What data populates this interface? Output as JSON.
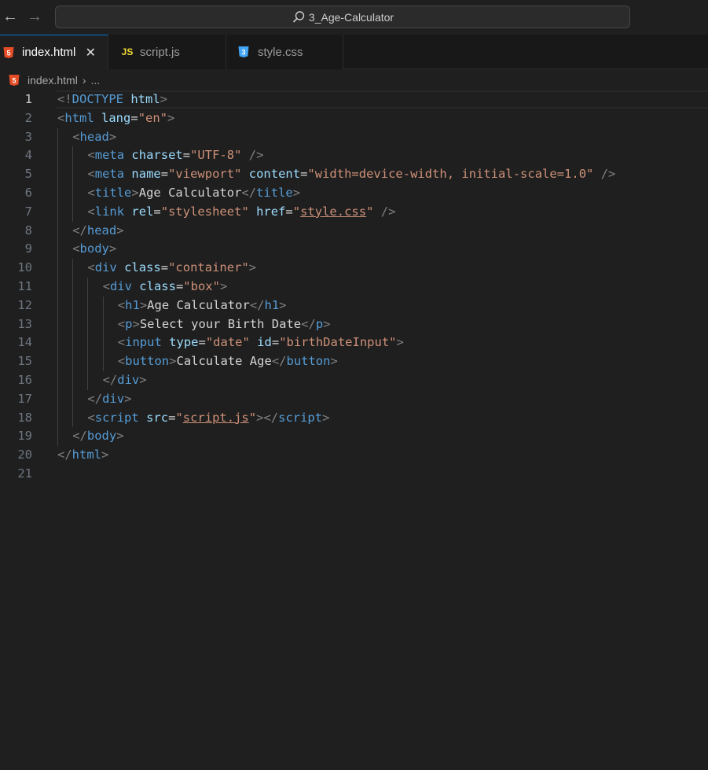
{
  "titlebar": {
    "search_text": "3_Age-Calculator"
  },
  "tabs": [
    {
      "label": "index.html",
      "icon": "html5-icon",
      "icon_glyph": "5",
      "icon_color": "#e44d26",
      "active": true
    },
    {
      "label": "script.js",
      "icon": "javascript-icon",
      "icon_glyph": "JS",
      "icon_color": "#f1dd35",
      "active": false
    },
    {
      "label": "style.css",
      "icon": "css3-icon",
      "icon_glyph": "3",
      "icon_color": "#42a5f5",
      "active": false
    }
  ],
  "breadcrumb": {
    "file": "index.html",
    "ellipsis": "..."
  },
  "editor": {
    "active_line": 1,
    "lines": [
      {
        "n": "1",
        "indent": 0,
        "tokens": [
          [
            "br",
            "<!"
          ],
          [
            "tag",
            "DOCTYPE"
          ],
          [
            "txt",
            " "
          ],
          [
            "attr",
            "html"
          ],
          [
            "br",
            ">"
          ]
        ]
      },
      {
        "n": "2",
        "indent": 0,
        "tokens": [
          [
            "br",
            "<"
          ],
          [
            "tag",
            "html"
          ],
          [
            "txt",
            " "
          ],
          [
            "attr",
            "lang"
          ],
          [
            "eq",
            "="
          ],
          [
            "str",
            "\"en\""
          ],
          [
            "br",
            ">"
          ]
        ]
      },
      {
        "n": "3",
        "indent": 1,
        "tokens": [
          [
            "br",
            "<"
          ],
          [
            "tag",
            "head"
          ],
          [
            "br",
            ">"
          ]
        ]
      },
      {
        "n": "4",
        "indent": 2,
        "tokens": [
          [
            "br",
            "<"
          ],
          [
            "tag",
            "meta"
          ],
          [
            "txt",
            " "
          ],
          [
            "attr",
            "charset"
          ],
          [
            "eq",
            "="
          ],
          [
            "str",
            "\"UTF-8\""
          ],
          [
            "txt",
            " "
          ],
          [
            "br",
            "/>"
          ]
        ]
      },
      {
        "n": "5",
        "indent": 2,
        "tokens": [
          [
            "br",
            "<"
          ],
          [
            "tag",
            "meta"
          ],
          [
            "txt",
            " "
          ],
          [
            "attr",
            "name"
          ],
          [
            "eq",
            "="
          ],
          [
            "str",
            "\"viewport\""
          ],
          [
            "txt",
            " "
          ],
          [
            "attr",
            "content"
          ],
          [
            "eq",
            "="
          ],
          [
            "str",
            "\"width=device-width, initial-scale=1.0\""
          ],
          [
            "txt",
            " "
          ],
          [
            "br",
            "/>"
          ]
        ]
      },
      {
        "n": "6",
        "indent": 2,
        "tokens": [
          [
            "br",
            "<"
          ],
          [
            "tag",
            "title"
          ],
          [
            "br",
            ">"
          ],
          [
            "txt",
            "Age Calculator"
          ],
          [
            "br",
            "</"
          ],
          [
            "tag",
            "title"
          ],
          [
            "br",
            ">"
          ]
        ]
      },
      {
        "n": "7",
        "indent": 2,
        "tokens": [
          [
            "br",
            "<"
          ],
          [
            "tag",
            "link"
          ],
          [
            "txt",
            " "
          ],
          [
            "attr",
            "rel"
          ],
          [
            "eq",
            "="
          ],
          [
            "str",
            "\"stylesheet\""
          ],
          [
            "txt",
            " "
          ],
          [
            "attr",
            "href"
          ],
          [
            "eq",
            "="
          ],
          [
            "str",
            "\""
          ],
          [
            "strlink",
            "style.css"
          ],
          [
            "str",
            "\""
          ],
          [
            "txt",
            " "
          ],
          [
            "br",
            "/>"
          ]
        ]
      },
      {
        "n": "8",
        "indent": 1,
        "tokens": [
          [
            "br",
            "</"
          ],
          [
            "tag",
            "head"
          ],
          [
            "br",
            ">"
          ]
        ]
      },
      {
        "n": "9",
        "indent": 1,
        "tokens": [
          [
            "br",
            "<"
          ],
          [
            "tag",
            "body"
          ],
          [
            "br",
            ">"
          ]
        ]
      },
      {
        "n": "10",
        "indent": 2,
        "tokens": [
          [
            "br",
            "<"
          ],
          [
            "tag",
            "div"
          ],
          [
            "txt",
            " "
          ],
          [
            "attr",
            "class"
          ],
          [
            "eq",
            "="
          ],
          [
            "str",
            "\"container\""
          ],
          [
            "br",
            ">"
          ]
        ]
      },
      {
        "n": "11",
        "indent": 3,
        "tokens": [
          [
            "br",
            "<"
          ],
          [
            "tag",
            "div"
          ],
          [
            "txt",
            " "
          ],
          [
            "attr",
            "class"
          ],
          [
            "eq",
            "="
          ],
          [
            "str",
            "\"box\""
          ],
          [
            "br",
            ">"
          ]
        ]
      },
      {
        "n": "12",
        "indent": 4,
        "tokens": [
          [
            "br",
            "<"
          ],
          [
            "tag",
            "h1"
          ],
          [
            "br",
            ">"
          ],
          [
            "txt",
            "Age Calculator"
          ],
          [
            "br",
            "</"
          ],
          [
            "tag",
            "h1"
          ],
          [
            "br",
            ">"
          ]
        ]
      },
      {
        "n": "13",
        "indent": 4,
        "tokens": [
          [
            "br",
            "<"
          ],
          [
            "tag",
            "p"
          ],
          [
            "br",
            ">"
          ],
          [
            "txt",
            "Select your Birth Date"
          ],
          [
            "br",
            "</"
          ],
          [
            "tag",
            "p"
          ],
          [
            "br",
            ">"
          ]
        ]
      },
      {
        "n": "14",
        "indent": 4,
        "tokens": [
          [
            "br",
            "<"
          ],
          [
            "tag",
            "input"
          ],
          [
            "txt",
            " "
          ],
          [
            "attr",
            "type"
          ],
          [
            "eq",
            "="
          ],
          [
            "str",
            "\"date\""
          ],
          [
            "txt",
            " "
          ],
          [
            "attr",
            "id"
          ],
          [
            "eq",
            "="
          ],
          [
            "str",
            "\"birthDateInput\""
          ],
          [
            "br",
            ">"
          ]
        ]
      },
      {
        "n": "15",
        "indent": 4,
        "tokens": [
          [
            "br",
            "<"
          ],
          [
            "tag",
            "button"
          ],
          [
            "br",
            ">"
          ],
          [
            "txt",
            "Calculate Age"
          ],
          [
            "br",
            "</"
          ],
          [
            "tag",
            "button"
          ],
          [
            "br",
            ">"
          ]
        ]
      },
      {
        "n": "16",
        "indent": 3,
        "tokens": [
          [
            "br",
            "</"
          ],
          [
            "tag",
            "div"
          ],
          [
            "br",
            ">"
          ]
        ]
      },
      {
        "n": "17",
        "indent": 2,
        "tokens": [
          [
            "br",
            "</"
          ],
          [
            "tag",
            "div"
          ],
          [
            "br",
            ">"
          ]
        ]
      },
      {
        "n": "18",
        "indent": 2,
        "tokens": [
          [
            "br",
            "<"
          ],
          [
            "tag",
            "script"
          ],
          [
            "txt",
            " "
          ],
          [
            "attr",
            "src"
          ],
          [
            "eq",
            "="
          ],
          [
            "str",
            "\""
          ],
          [
            "strlink",
            "script.js"
          ],
          [
            "str",
            "\""
          ],
          [
            "br",
            "></"
          ],
          [
            "tag",
            "script"
          ],
          [
            "br",
            ">"
          ]
        ]
      },
      {
        "n": "19",
        "indent": 1,
        "tokens": [
          [
            "br",
            "</"
          ],
          [
            "tag",
            "body"
          ],
          [
            "br",
            ">"
          ]
        ]
      },
      {
        "n": "20",
        "indent": 0,
        "tokens": [
          [
            "br",
            "</"
          ],
          [
            "tag",
            "html"
          ],
          [
            "br",
            ">"
          ]
        ]
      },
      {
        "n": "21",
        "indent": 0,
        "tokens": []
      }
    ]
  }
}
